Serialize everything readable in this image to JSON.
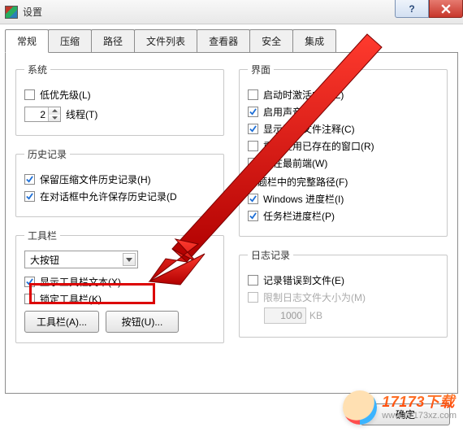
{
  "window": {
    "title": "设置",
    "help_glyph": "?",
    "close_glyph": "×"
  },
  "tabs": [
    "常规",
    "压缩",
    "路径",
    "文件列表",
    "查看器",
    "安全",
    "集成"
  ],
  "active_tab_index": 0,
  "groups": {
    "system": {
      "legend": "系统",
      "low_priority": "低优先级(L)",
      "threads_value": "2",
      "threads_label": "线程(T)"
    },
    "history": {
      "legend": "历史记录",
      "keep_archive_history": "保留压缩文件历史记录(H)",
      "allow_dialog_history": "在对话框中允许保存历史记录(D"
    },
    "toolbar": {
      "legend": "工具栏",
      "style_selected": "大按钮",
      "show_text": "显示工具栏文本(X)",
      "lock_toolbar": "锁定工具栏(K)",
      "btn_toolbars": "工具栏(A)...",
      "btn_buttons": "按钮(U)..."
    },
    "interface": {
      "legend": "界面",
      "wizard_on_start": "启动时激活向导(Z)",
      "enable_sound": "启用声音(S)",
      "show_comments": "显示压缩文件注释(C)",
      "reuse_window": "重复使用已存在的窗口(R)",
      "always_on_top": "总在最前端(W)",
      "full_path_title": "标题栏中的完整路径(F)",
      "win_progress": "Windows 进度栏(I)",
      "taskbar_progress": "任务栏进度栏(P)"
    },
    "log": {
      "legend": "日志记录",
      "log_errors": "记录错误到文件(E)",
      "limit_log_size": "限制日志文件大小为(M)",
      "size_value": "1000",
      "size_unit": "KB"
    }
  },
  "footer": {
    "ok": "确定"
  },
  "watermark": {
    "brand": "17173下载",
    "url": "www.17173xz.com"
  }
}
